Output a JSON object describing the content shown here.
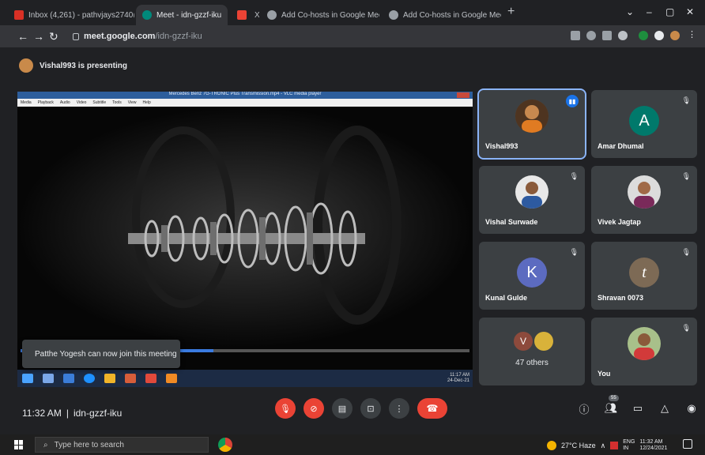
{
  "browser": {
    "tabs": [
      {
        "label": "Inbox (4,261) - pathvjays2740@",
        "icon_color": "#d93025",
        "active": false
      },
      {
        "label": "Meet - idn-gzzf-iku",
        "icon_color": "#00897b",
        "active": true
      },
      {
        "label": "",
        "icon_color": "#ea4335",
        "active": false
      },
      {
        "label": "Add Co-hosts in Google Meet - ",
        "icon_color": "#5f6368",
        "active": false
      },
      {
        "label": "Add Co-hosts in Google Meet - ",
        "icon_color": "#5f6368",
        "active": false
      }
    ],
    "close_glyph": "X",
    "new_tab_glyph": "+",
    "url_host": "meet.google.com",
    "url_path": "/idn-gzzf-iku"
  },
  "meet": {
    "presenting_text": "Vishal993 is presenting",
    "vlc_title": "Mercedes Benz 7G-TRONIC Plus Transmission.mp4 - VLC media player",
    "vlc_menu": [
      "Media",
      "Playback",
      "Audio",
      "Video",
      "Subtitle",
      "Tools",
      "View",
      "Help"
    ],
    "vlc_progress": 0.43,
    "vlc_clock_time": "11:17 AM",
    "vlc_clock_date": "24-Dec-21",
    "toast": "Patthe Yogesh can now join this meeting",
    "participants": [
      {
        "name": "Vishal993",
        "type": "photo",
        "speaking": true
      },
      {
        "name": "Amar Dhumal",
        "type": "letter",
        "letter": "A",
        "color": "#00796b"
      },
      {
        "name": "Vishal Surwade",
        "type": "photo"
      },
      {
        "name": "Vivek Jagtap",
        "type": "photo"
      },
      {
        "name": "Kunal Gulde",
        "type": "letter",
        "letter": "K",
        "color": "#5c6bc0"
      },
      {
        "name": "Shravan 0073",
        "type": "letter",
        "letter": "t",
        "color": "#7d6a55"
      },
      {
        "name": "47 others",
        "type": "group",
        "letter": "V",
        "color": "#8d4a3c"
      },
      {
        "name": "You",
        "type": "photo"
      }
    ],
    "time": "11:32 AM",
    "separator": "|",
    "meeting_code": "idn-gzzf-iku",
    "people_badge": "55"
  },
  "taskbar": {
    "search_placeholder": "Type here to search",
    "weather": "27°C Haze",
    "lang_top": "ENG",
    "lang_bottom": "IN",
    "clock_time": "11:32 AM",
    "clock_date": "12/24/2021"
  }
}
